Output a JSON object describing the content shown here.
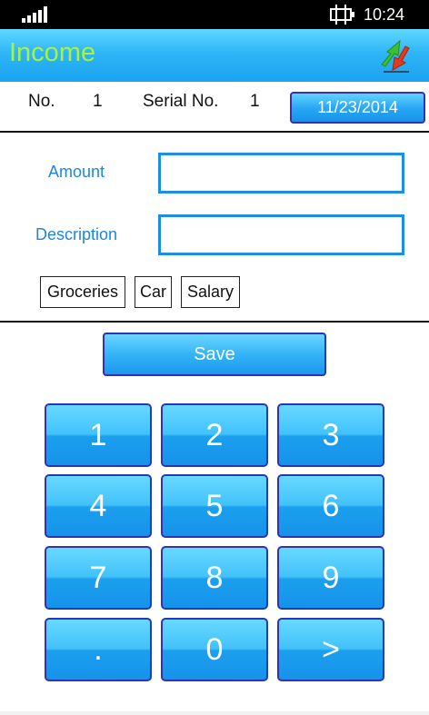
{
  "status_bar": {
    "time": "10:24",
    "signal_icon": "signal-strength-icon",
    "battery_icon": "battery-charging-icon"
  },
  "header": {
    "title": "Income",
    "title_color": "#a8f33f",
    "action_icon": "swap-arrows-icon"
  },
  "info": {
    "no_label": "No.",
    "no_value": "1",
    "serial_label": "Serial No.",
    "serial_value": "1",
    "date": "11/23/2014"
  },
  "form": {
    "amount_label": "Amount",
    "amount_value": "",
    "description_label": "Description",
    "description_value": ""
  },
  "tags": [
    "Groceries",
    "Car",
    "Salary"
  ],
  "save_label": "Save",
  "keypad": [
    "1",
    "2",
    "3",
    "4",
    "5",
    "6",
    "7",
    "8",
    "9",
    ".",
    "0",
    ">"
  ],
  "colors": {
    "accent": "#1c8ee6",
    "button_border": "#2a35b8",
    "label": "#1d86e0"
  }
}
